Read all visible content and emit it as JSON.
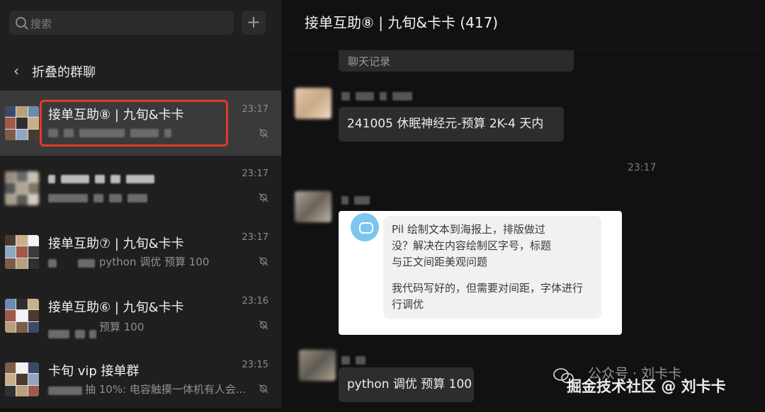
{
  "sidebar": {
    "search_placeholder": "搜索",
    "add_label": "+",
    "back_label": "折叠的群聊",
    "items": [
      {
        "title": "接单互助⑧ | 九旬&卡卡",
        "preview": "",
        "time": "23:17",
        "active": true
      },
      {
        "title": "",
        "preview": "",
        "time": "23:17",
        "active": false
      },
      {
        "title": "接单互助⑦ | 九旬&卡卡",
        "preview": "python 调优  预算 100",
        "time": "23:17",
        "active": false
      },
      {
        "title": "接单互助⑥ | 九旬&卡卡",
        "preview": "预算 100",
        "time": "23:16",
        "active": false
      },
      {
        "title": "卡旬 vip 接单群",
        "preview": "抽 10%: 电容触摸一体机有人会...",
        "time": "23:15",
        "active": false
      }
    ]
  },
  "chat": {
    "title": "接单互助⑧ | 九旬&卡卡  (417)",
    "record_label": "聊天记录",
    "messages": {
      "m1": "241005 休眠神经元-预算 2K-4 天内",
      "timestamp": "23:17",
      "quote_line1": "Pil 绘制文本到海报上，排版做过",
      "quote_line2": "没？解决在内容绘制区字号，标题",
      "quote_line3": "与正文间距美观问题",
      "quote_line4": "我代码写好的，但需要对间距，字体进行",
      "quote_line5": "行调优",
      "m3": "python 调优  预算 100"
    }
  },
  "watermark": {
    "line1": "公众号 · 刘卡卡",
    "line2": "掘金技术社区 @ 刘卡卡"
  }
}
